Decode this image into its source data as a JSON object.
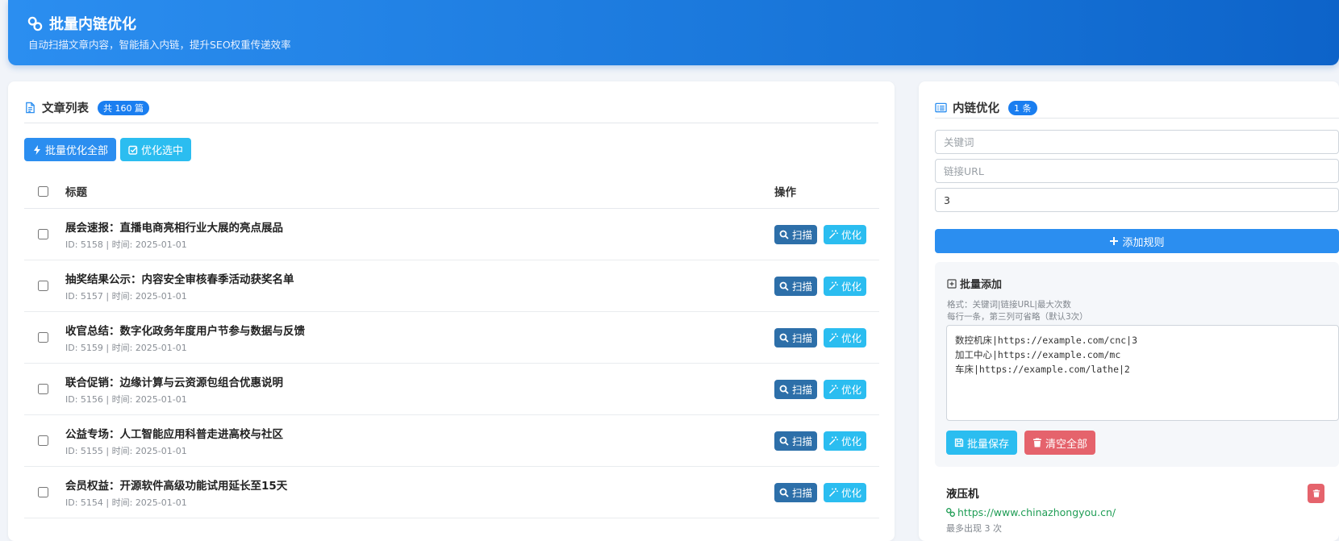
{
  "header": {
    "title": "批量内链优化",
    "subtitle": "自动扫描文章内容，智能插入内链，提升SEO权重传递效率"
  },
  "articles": {
    "title": "文章列表",
    "count_badge": "共 160 篇",
    "batch_optimize_all": "批量优化全部",
    "optimize_selected": "优化选中",
    "col_title": "标题",
    "col_ops": "操作",
    "scan_label": "扫描",
    "optimize_label": "优化",
    "rows": [
      {
        "title": "展会速报：直播电商亮相行业大展的亮点展品",
        "meta": "ID: 5158 | 时间: 2025-01-01"
      },
      {
        "title": "抽奖结果公示：内容安全审核春季活动获奖名单",
        "meta": "ID: 5157 | 时间: 2025-01-01"
      },
      {
        "title": "收官总结：数字化政务年度用户节参与数据与反馈",
        "meta": "ID: 5159 | 时间: 2025-01-01"
      },
      {
        "title": "联合促销：边缘计算与云资源包组合优惠说明",
        "meta": "ID: 5156 | 时间: 2025-01-01"
      },
      {
        "title": "公益专场：人工智能应用科普走进高校与社区",
        "meta": "ID: 5155 | 时间: 2025-01-01"
      },
      {
        "title": "会员权益：开源软件高级功能试用延长至15天",
        "meta": "ID: 5154 | 时间: 2025-01-01"
      }
    ]
  },
  "links": {
    "title": "内链优化",
    "count_badge": "1 条",
    "keyword_placeholder": "关键词",
    "url_placeholder": "链接URL",
    "max_value": "3",
    "add_rule": "添加规则",
    "batch": {
      "title": "批量添加",
      "hint_format": "格式：关键词|链接URL|最大次数",
      "hint_line": "每行一条，第三列可省略（默认3次）",
      "content": "数控机床|https://example.com/cnc|3\n加工中心|https://example.com/mc\n车床|https://example.com/lathe|2",
      "save": "批量保存",
      "clear": "清空全部"
    },
    "rules": [
      {
        "keyword": "液压机",
        "url": "https://www.chinazhongyou.cn/",
        "limit": "最多出现 3 次"
      }
    ]
  }
}
